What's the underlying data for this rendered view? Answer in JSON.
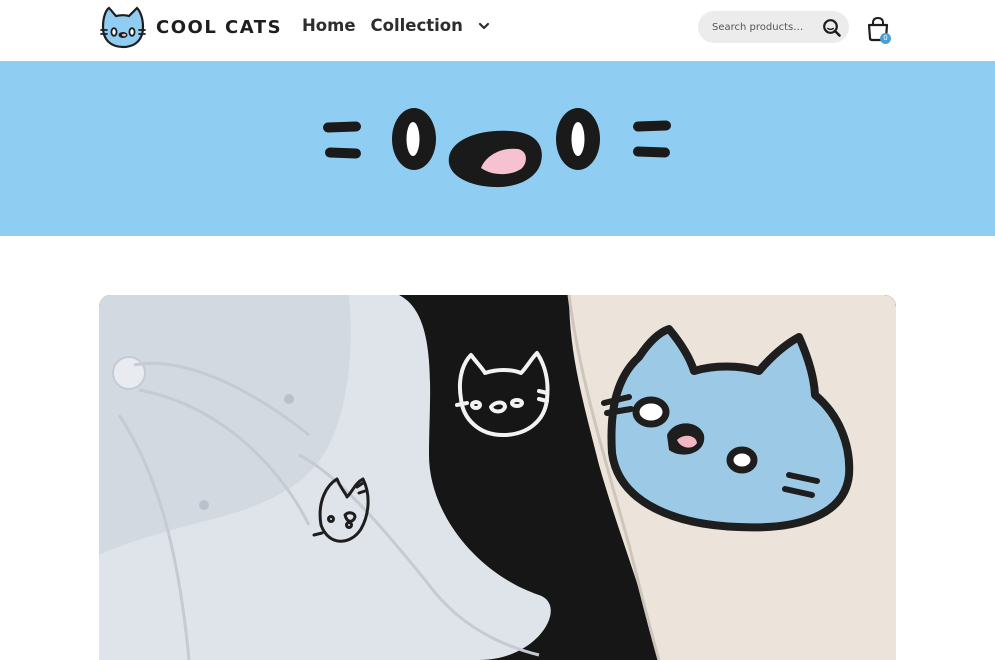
{
  "brand": {
    "name": "COOL CATS",
    "logo_icon": "cat-face-logo"
  },
  "nav": {
    "items": [
      {
        "label": "Home"
      },
      {
        "label": "Collection"
      }
    ],
    "dropdown_icon": "chevron-down-icon"
  },
  "search": {
    "placeholder": "Search products…",
    "icon": "search-icon"
  },
  "cart": {
    "icon": "shopping-bag-icon",
    "count": "0"
  },
  "banner": {
    "background": "#8fcdf2",
    "art": "cat-face-illustration"
  },
  "hero_image": {
    "subjects": [
      "light-blue cap with cat embroidery",
      "black shirt with white cat outline",
      "cream shirt with blue cat face"
    ]
  },
  "colors": {
    "accent": "#8fcdf2",
    "badge": "#4a9fd0",
    "text": "#2d2d2d"
  }
}
